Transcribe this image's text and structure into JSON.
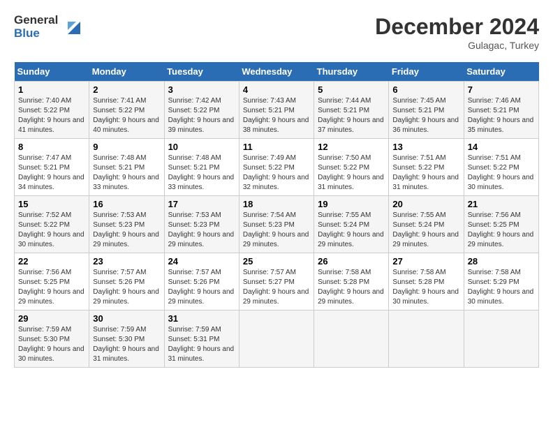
{
  "header": {
    "logo_line1": "General",
    "logo_line2": "Blue",
    "month_year": "December 2024",
    "location": "Gulagac, Turkey"
  },
  "days_of_week": [
    "Sunday",
    "Monday",
    "Tuesday",
    "Wednesday",
    "Thursday",
    "Friday",
    "Saturday"
  ],
  "weeks": [
    [
      {
        "day": "1",
        "sunrise": "7:40 AM",
        "sunset": "5:22 PM",
        "daylight": "9 hours and 41 minutes."
      },
      {
        "day": "2",
        "sunrise": "7:41 AM",
        "sunset": "5:22 PM",
        "daylight": "9 hours and 40 minutes."
      },
      {
        "day": "3",
        "sunrise": "7:42 AM",
        "sunset": "5:22 PM",
        "daylight": "9 hours and 39 minutes."
      },
      {
        "day": "4",
        "sunrise": "7:43 AM",
        "sunset": "5:21 PM",
        "daylight": "9 hours and 38 minutes."
      },
      {
        "day": "5",
        "sunrise": "7:44 AM",
        "sunset": "5:21 PM",
        "daylight": "9 hours and 37 minutes."
      },
      {
        "day": "6",
        "sunrise": "7:45 AM",
        "sunset": "5:21 PM",
        "daylight": "9 hours and 36 minutes."
      },
      {
        "day": "7",
        "sunrise": "7:46 AM",
        "sunset": "5:21 PM",
        "daylight": "9 hours and 35 minutes."
      }
    ],
    [
      {
        "day": "8",
        "sunrise": "7:47 AM",
        "sunset": "5:21 PM",
        "daylight": "9 hours and 34 minutes."
      },
      {
        "day": "9",
        "sunrise": "7:48 AM",
        "sunset": "5:21 PM",
        "daylight": "9 hours and 33 minutes."
      },
      {
        "day": "10",
        "sunrise": "7:48 AM",
        "sunset": "5:21 PM",
        "daylight": "9 hours and 33 minutes."
      },
      {
        "day": "11",
        "sunrise": "7:49 AM",
        "sunset": "5:22 PM",
        "daylight": "9 hours and 32 minutes."
      },
      {
        "day": "12",
        "sunrise": "7:50 AM",
        "sunset": "5:22 PM",
        "daylight": "9 hours and 31 minutes."
      },
      {
        "day": "13",
        "sunrise": "7:51 AM",
        "sunset": "5:22 PM",
        "daylight": "9 hours and 31 minutes."
      },
      {
        "day": "14",
        "sunrise": "7:51 AM",
        "sunset": "5:22 PM",
        "daylight": "9 hours and 30 minutes."
      }
    ],
    [
      {
        "day": "15",
        "sunrise": "7:52 AM",
        "sunset": "5:22 PM",
        "daylight": "9 hours and 30 minutes."
      },
      {
        "day": "16",
        "sunrise": "7:53 AM",
        "sunset": "5:23 PM",
        "daylight": "9 hours and 29 minutes."
      },
      {
        "day": "17",
        "sunrise": "7:53 AM",
        "sunset": "5:23 PM",
        "daylight": "9 hours and 29 minutes."
      },
      {
        "day": "18",
        "sunrise": "7:54 AM",
        "sunset": "5:23 PM",
        "daylight": "9 hours and 29 minutes."
      },
      {
        "day": "19",
        "sunrise": "7:55 AM",
        "sunset": "5:24 PM",
        "daylight": "9 hours and 29 minutes."
      },
      {
        "day": "20",
        "sunrise": "7:55 AM",
        "sunset": "5:24 PM",
        "daylight": "9 hours and 29 minutes."
      },
      {
        "day": "21",
        "sunrise": "7:56 AM",
        "sunset": "5:25 PM",
        "daylight": "9 hours and 29 minutes."
      }
    ],
    [
      {
        "day": "22",
        "sunrise": "7:56 AM",
        "sunset": "5:25 PM",
        "daylight": "9 hours and 29 minutes."
      },
      {
        "day": "23",
        "sunrise": "7:57 AM",
        "sunset": "5:26 PM",
        "daylight": "9 hours and 29 minutes."
      },
      {
        "day": "24",
        "sunrise": "7:57 AM",
        "sunset": "5:26 PM",
        "daylight": "9 hours and 29 minutes."
      },
      {
        "day": "25",
        "sunrise": "7:57 AM",
        "sunset": "5:27 PM",
        "daylight": "9 hours and 29 minutes."
      },
      {
        "day": "26",
        "sunrise": "7:58 AM",
        "sunset": "5:28 PM",
        "daylight": "9 hours and 29 minutes."
      },
      {
        "day": "27",
        "sunrise": "7:58 AM",
        "sunset": "5:28 PM",
        "daylight": "9 hours and 30 minutes."
      },
      {
        "day": "28",
        "sunrise": "7:58 AM",
        "sunset": "5:29 PM",
        "daylight": "9 hours and 30 minutes."
      }
    ],
    [
      {
        "day": "29",
        "sunrise": "7:59 AM",
        "sunset": "5:30 PM",
        "daylight": "9 hours and 30 minutes."
      },
      {
        "day": "30",
        "sunrise": "7:59 AM",
        "sunset": "5:30 PM",
        "daylight": "9 hours and 31 minutes."
      },
      {
        "day": "31",
        "sunrise": "7:59 AM",
        "sunset": "5:31 PM",
        "daylight": "9 hours and 31 minutes."
      },
      null,
      null,
      null,
      null
    ]
  ]
}
